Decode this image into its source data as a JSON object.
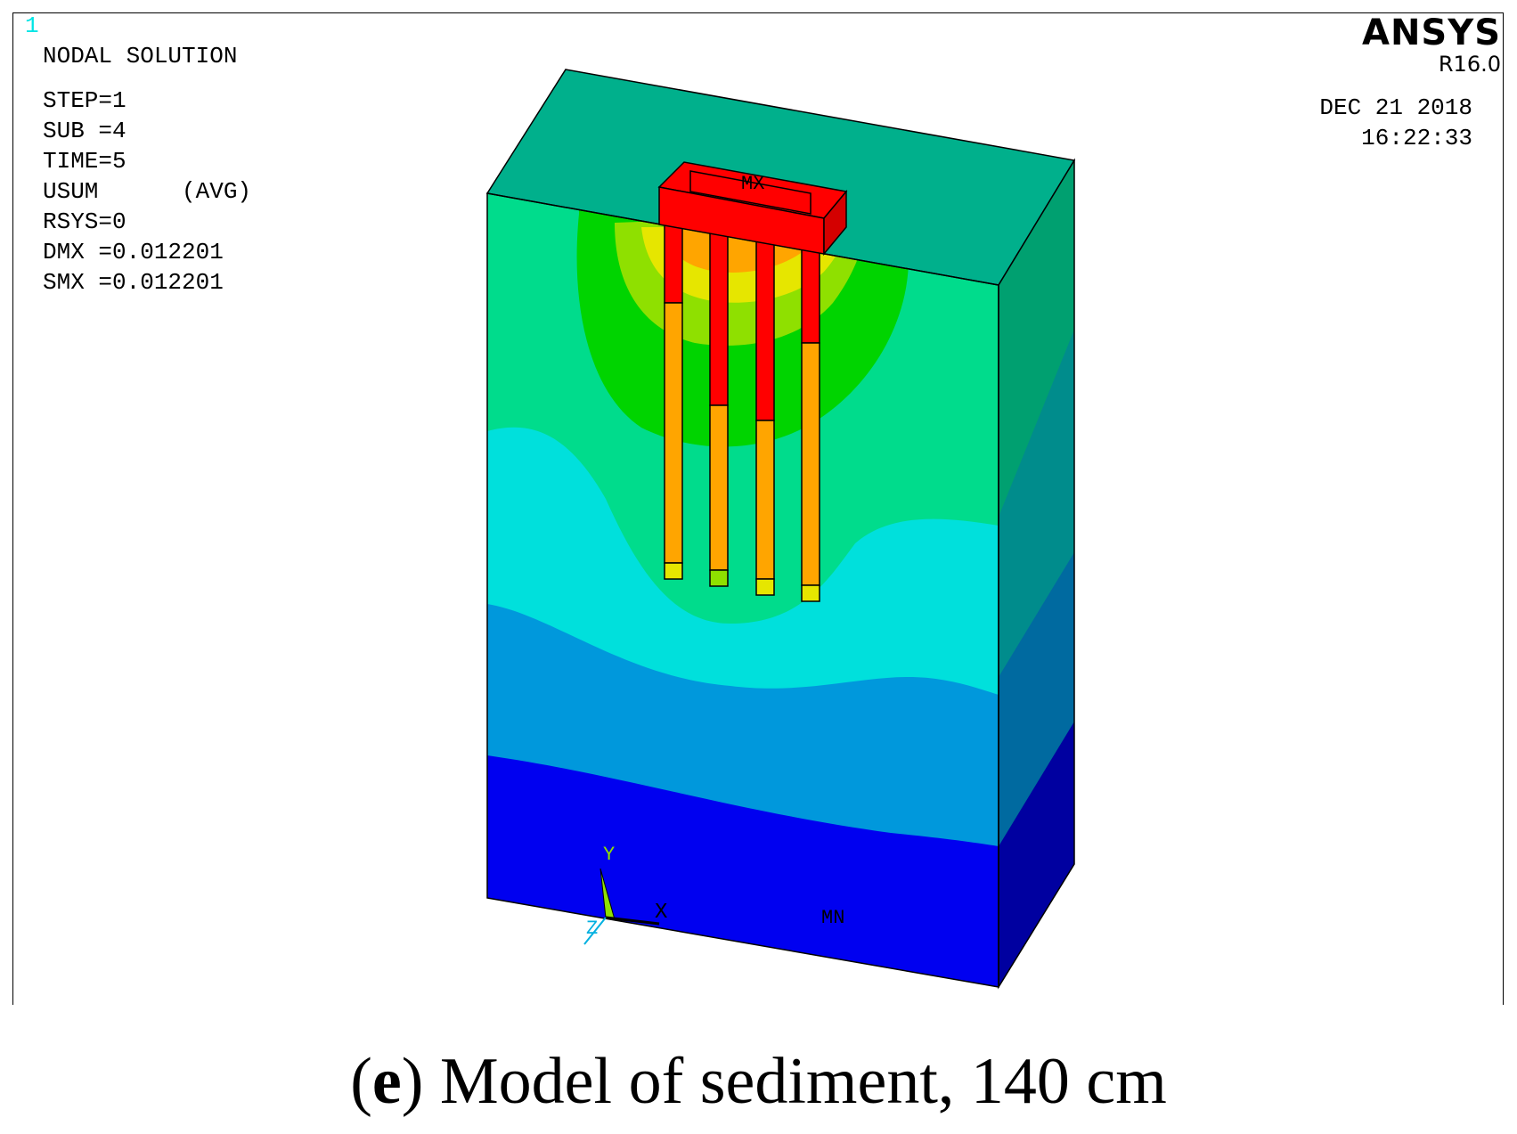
{
  "window_number": "1",
  "plot_type": "NODAL SOLUTION",
  "solution_info": [
    "STEP=1",
    "SUB =4",
    "TIME=5",
    "USUM      (AVG)",
    "RSYS=0",
    "DMX =0.012201",
    "SMX =0.012201"
  ],
  "brand": "ANSYS",
  "release": "R16.0",
  "date": "DEC 21 2018",
  "time": "16:22:33",
  "labels": {
    "max": "MX",
    "min": "MN"
  },
  "axes": {
    "y": "Y",
    "x": "X",
    "z": "Z"
  },
  "caption": {
    "letter": "e",
    "text": "Model of sediment, 140 cm"
  },
  "colors": {
    "red": "#ff0000",
    "orange": "#ffa500",
    "yellow": "#e6e600",
    "lime": "#8fe000",
    "green": "#00d400",
    "sea_green": "#00dc8c",
    "teal": "#00b08c",
    "cyan": "#00e0dc",
    "light_blue": "#0098dc",
    "blue": "#0000f0",
    "navy": "#0000a0"
  }
}
